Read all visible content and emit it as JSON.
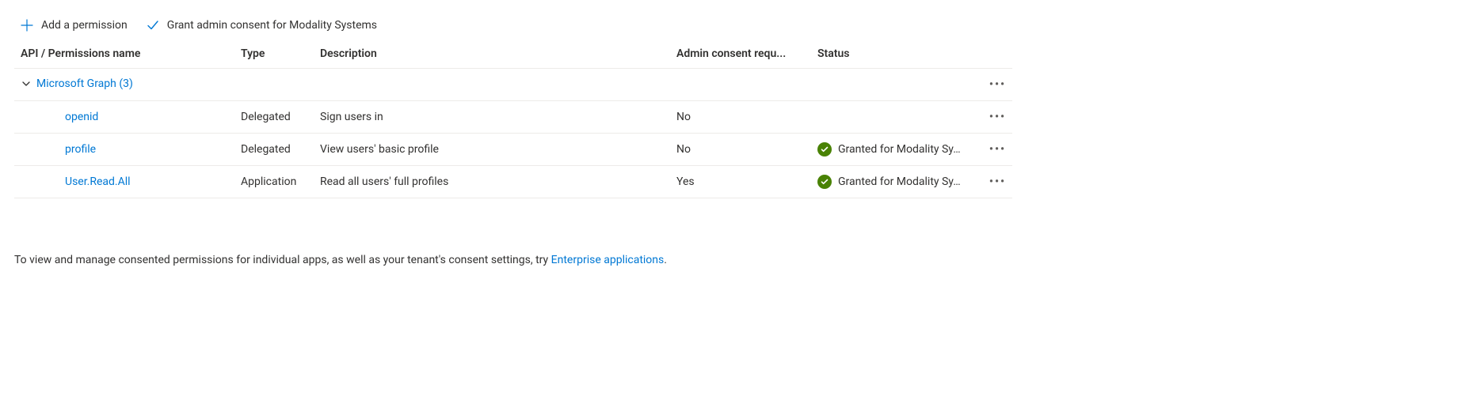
{
  "toolbar": {
    "add_permission_label": "Add a permission",
    "grant_consent_label": "Grant admin consent for Modality Systems"
  },
  "columns": {
    "name": "API / Permissions name",
    "type": "Type",
    "description": "Description",
    "admin_consent": "Admin consent requ...",
    "status": "Status"
  },
  "group": {
    "label": "Microsoft Graph (3)"
  },
  "permissions": [
    {
      "name": "openid",
      "type": "Delegated",
      "description": "Sign users in",
      "admin_consent": "No",
      "status_text": "",
      "status_granted": false
    },
    {
      "name": "profile",
      "type": "Delegated",
      "description": "View users' basic profile",
      "admin_consent": "No",
      "status_text": "Granted for Modality Sy…",
      "status_granted": true
    },
    {
      "name": "User.Read.All",
      "type": "Application",
      "description": "Read all users' full profiles",
      "admin_consent": "Yes",
      "status_text": "Granted for Modality Sy…",
      "status_granted": true
    }
  ],
  "footer": {
    "text_before": "To view and manage consented permissions for individual apps, as well as your tenant's consent settings, try ",
    "link_text": "Enterprise applications",
    "text_after": "."
  }
}
